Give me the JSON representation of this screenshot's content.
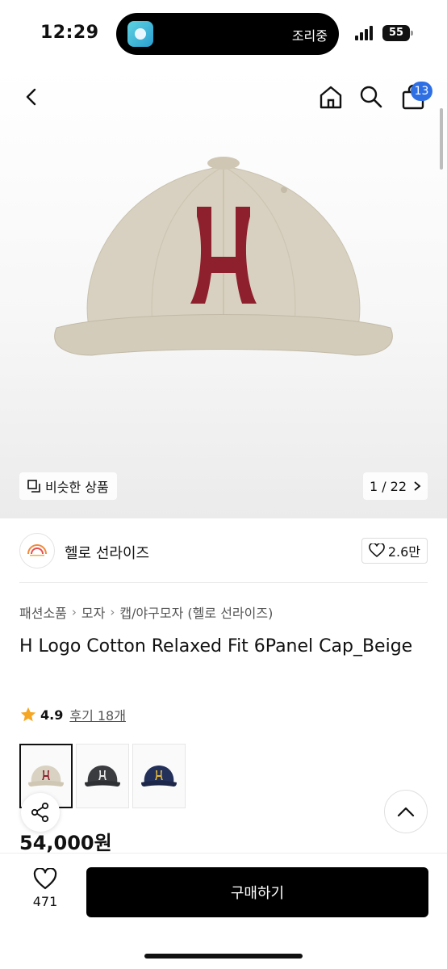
{
  "status_bar": {
    "time": "12:29",
    "island_text": "조리중",
    "battery": "55"
  },
  "header": {
    "back_icon": "chevron-left-icon",
    "home_icon": "home-icon",
    "search_icon": "search-icon",
    "cart_icon": "shopping-bag-icon",
    "cart_badge": "13"
  },
  "gallery": {
    "similar_label": "비슷한 상품",
    "page_indicator": "1 / 22"
  },
  "brand": {
    "name": "헬로 선라이즈",
    "like_count": "2.6만"
  },
  "breadcrumb": [
    "패션소품",
    "모자",
    "캡/야구모자 (헬로 선라이즈)"
  ],
  "product": {
    "title": "H Logo Cotton Relaxed Fit 6Panel Cap_Beige",
    "rating": "4.9",
    "review_label": "후기 18개",
    "price": "54,000원"
  },
  "colors": [
    {
      "cap": "#d9d2c2",
      "letter": "#8e1f2c",
      "selected": true
    },
    {
      "cap": "#3a3c40",
      "letter": "#e8e8e8",
      "selected": false
    },
    {
      "cap": "#23305a",
      "letter": "#e0b63a",
      "selected": false
    }
  ],
  "bottom": {
    "wish_count": "471",
    "buy_label": "구매하기"
  },
  "accent": {
    "badge": "#2f6fe4",
    "star": "#f5a623",
    "buy_bg": "#000000"
  }
}
